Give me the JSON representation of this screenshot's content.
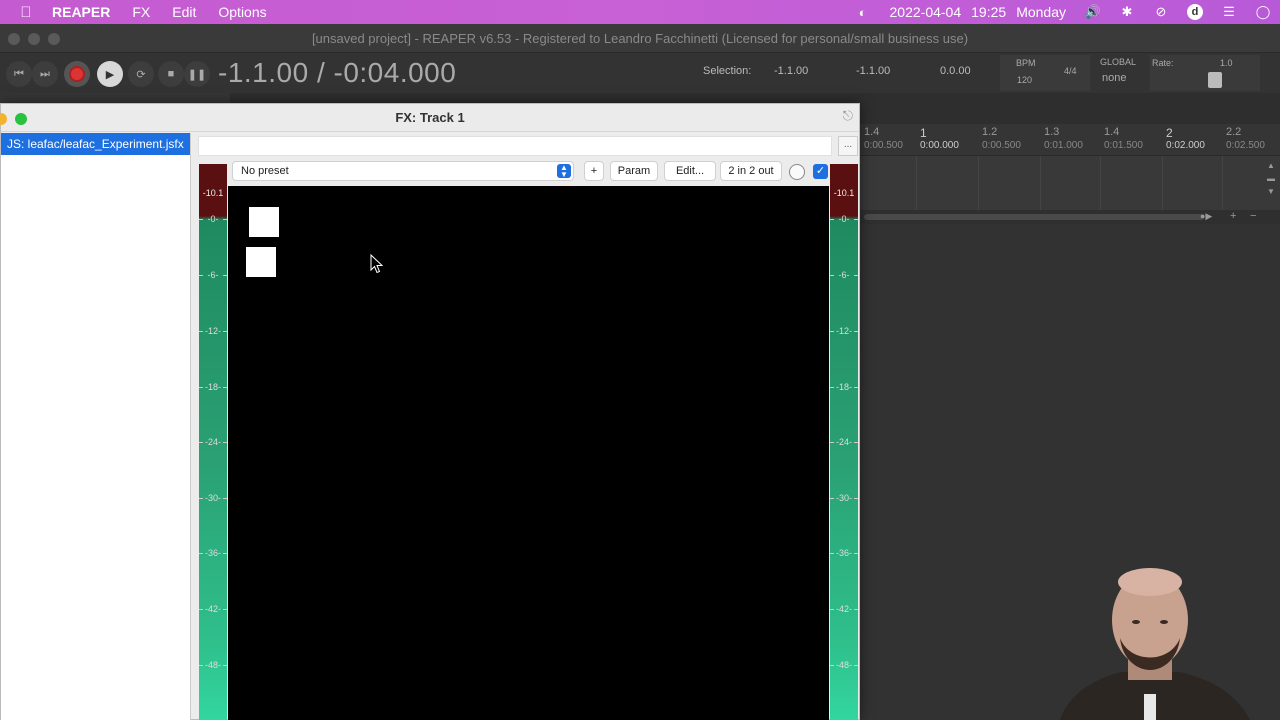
{
  "menubar": {
    "app": "REAPER",
    "items": [
      "FX",
      "Edit",
      "Options"
    ],
    "date": "2022-04-04",
    "time": "19:25",
    "day": "Monday",
    "avatar_letter": "d"
  },
  "window": {
    "title": "[unsaved project] - REAPER v6.53 - Registered to Leandro Facchinetti (Licensed for personal/small business use)"
  },
  "transport": {
    "timecode": "-1.1.00 / -0:04.000",
    "selection_label": "Selection:",
    "sel_start": "-1.1.00",
    "sel_end": "-1.1.00",
    "sel_len": "0.0.00",
    "bpm_label": "BPM",
    "bpm": "120",
    "timesig": "4/4",
    "global_label": "GLOBAL",
    "global_value": "none",
    "rate_label": "Rate:",
    "rate": "1.0"
  },
  "ruler": {
    "bars": [
      "1.4",
      "1",
      "1.2",
      "1.3",
      "1.4",
      "2",
      "2.2"
    ],
    "times": [
      "0:00.500",
      "0:00.000",
      "0:00.500",
      "0:01.000",
      "0:01.500",
      "0:02.000",
      "0:02.500"
    ]
  },
  "fx": {
    "title": "FX: Track 1",
    "plugin": "JS: leafac/leafac_Experiment.jsfx",
    "preset": "No preset",
    "add": "+",
    "param": "Param",
    "edit": "Edit...",
    "io": "2 in 2 out",
    "more": "...",
    "meter_peak": "-10.1",
    "meter_marks": [
      "-0-",
      "-6-",
      "-12-",
      "-18-",
      "-24-",
      "-30-",
      "-36-",
      "-42-",
      "-48-"
    ]
  },
  "colors": {
    "menubar": "#c45bd0",
    "accent": "#1e6fe0",
    "canvas": "#000000"
  }
}
